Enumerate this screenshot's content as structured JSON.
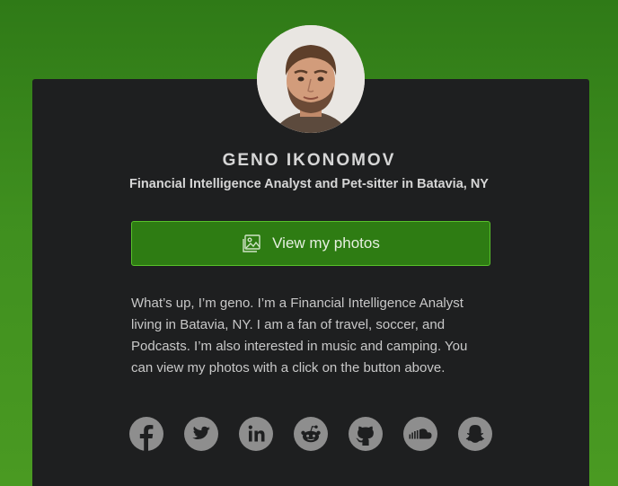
{
  "profile": {
    "name": "GENO IKONOMOV",
    "tagline": "Financial Intelligence Analyst and Pet-sitter in Batavia, NY",
    "photos_button": "View my photos",
    "bio": "What’s up, I’m geno. I’m a Financial Intelligence Analyst living in Batavia, NY. I am a fan of travel, soccer, and Podcasts. I’m also interested in music and camping. You can view my photos with a click on the button above."
  },
  "socials": [
    "facebook-icon",
    "twitter-icon",
    "linkedin-icon",
    "reddit-icon",
    "github-icon",
    "soundcloud-icon",
    "snapchat-icon"
  ],
  "colors": {
    "background": "#3f8f1f",
    "card": "#1e1f20",
    "button": "#2e7c13",
    "button_border": "#58c22a",
    "icon": "#8e8e8e"
  }
}
